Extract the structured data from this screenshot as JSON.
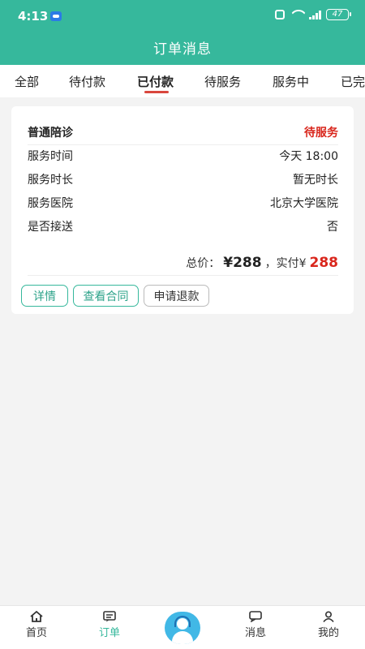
{
  "status_bar": {
    "time": "4:13",
    "battery": "47"
  },
  "header": {
    "title": "订单消息"
  },
  "tabs": [
    {
      "label": "全部",
      "active": false
    },
    {
      "label": "待付款",
      "active": false
    },
    {
      "label": "已付款",
      "active": true
    },
    {
      "label": "待服务",
      "active": false
    },
    {
      "label": "服务中",
      "active": false
    },
    {
      "label": "已完",
      "active": false
    }
  ],
  "order": {
    "service_type": "普通陪诊",
    "status": "待服务",
    "rows": [
      {
        "label": "服务时间",
        "value": "今天 18:00"
      },
      {
        "label": "服务时长",
        "value": "暂无时长"
      },
      {
        "label": "服务医院",
        "value": "北京大学医院"
      },
      {
        "label": "是否接送",
        "value": "否"
      }
    ],
    "total_label": "总价：",
    "total_value": "¥288",
    "paid_label": "，实付¥",
    "paid_value": "288",
    "buttons": {
      "detail": "详情",
      "contract": "查看合同",
      "refund": "申请退款"
    }
  },
  "bottom_nav": {
    "home": "首页",
    "orders": "订单",
    "messages": "消息",
    "mine": "我的"
  },
  "colors": {
    "brand": "#36b89c",
    "accent_red": "#d9261c"
  }
}
